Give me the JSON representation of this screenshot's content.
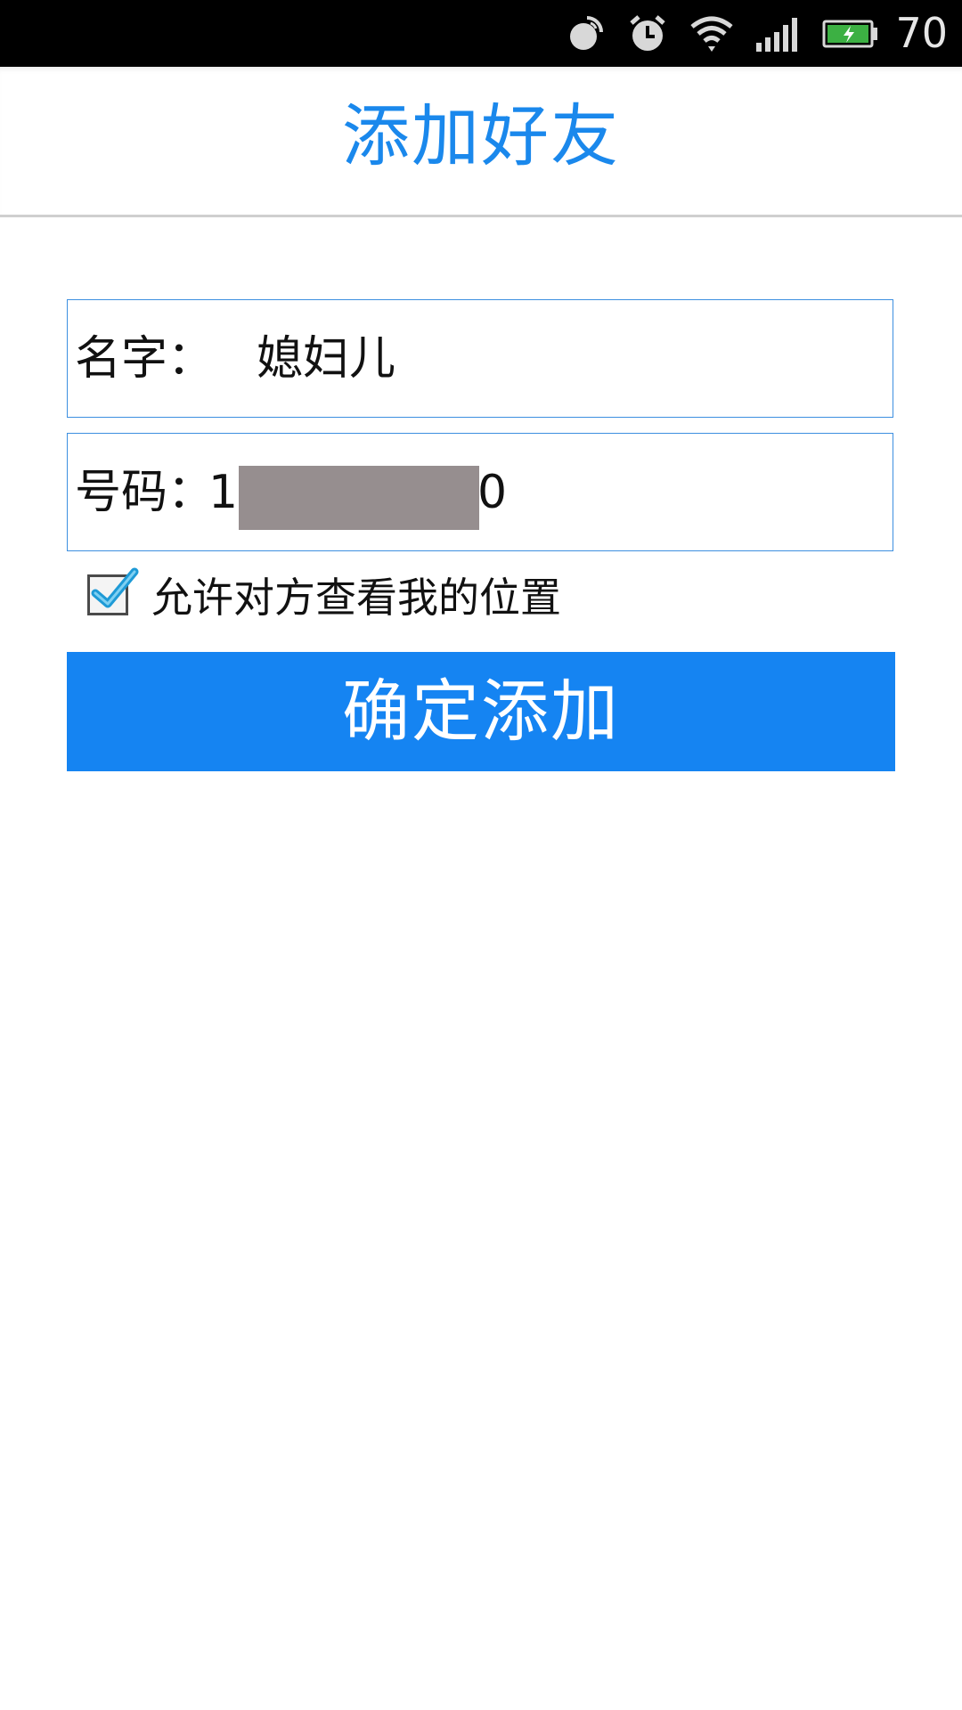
{
  "status_bar": {
    "battery_percent": "70",
    "icons": [
      "screen-rotation-icon",
      "alarm-icon",
      "wifi-icon",
      "signal-icon",
      "battery-icon"
    ]
  },
  "header": {
    "title": "添加好友"
  },
  "form": {
    "name_label": "名字：",
    "name_value": "媳妇儿",
    "phone_label": "号码：",
    "phone_prefix": "1",
    "phone_suffix": "0",
    "allow_location_label": "允许对方查看我的位置",
    "allow_location_checked": true,
    "submit_label": "确定添加"
  },
  "colors": {
    "accent": "#1a88ec",
    "button": "#1584f2",
    "field_border": "#3d8fe0"
  }
}
